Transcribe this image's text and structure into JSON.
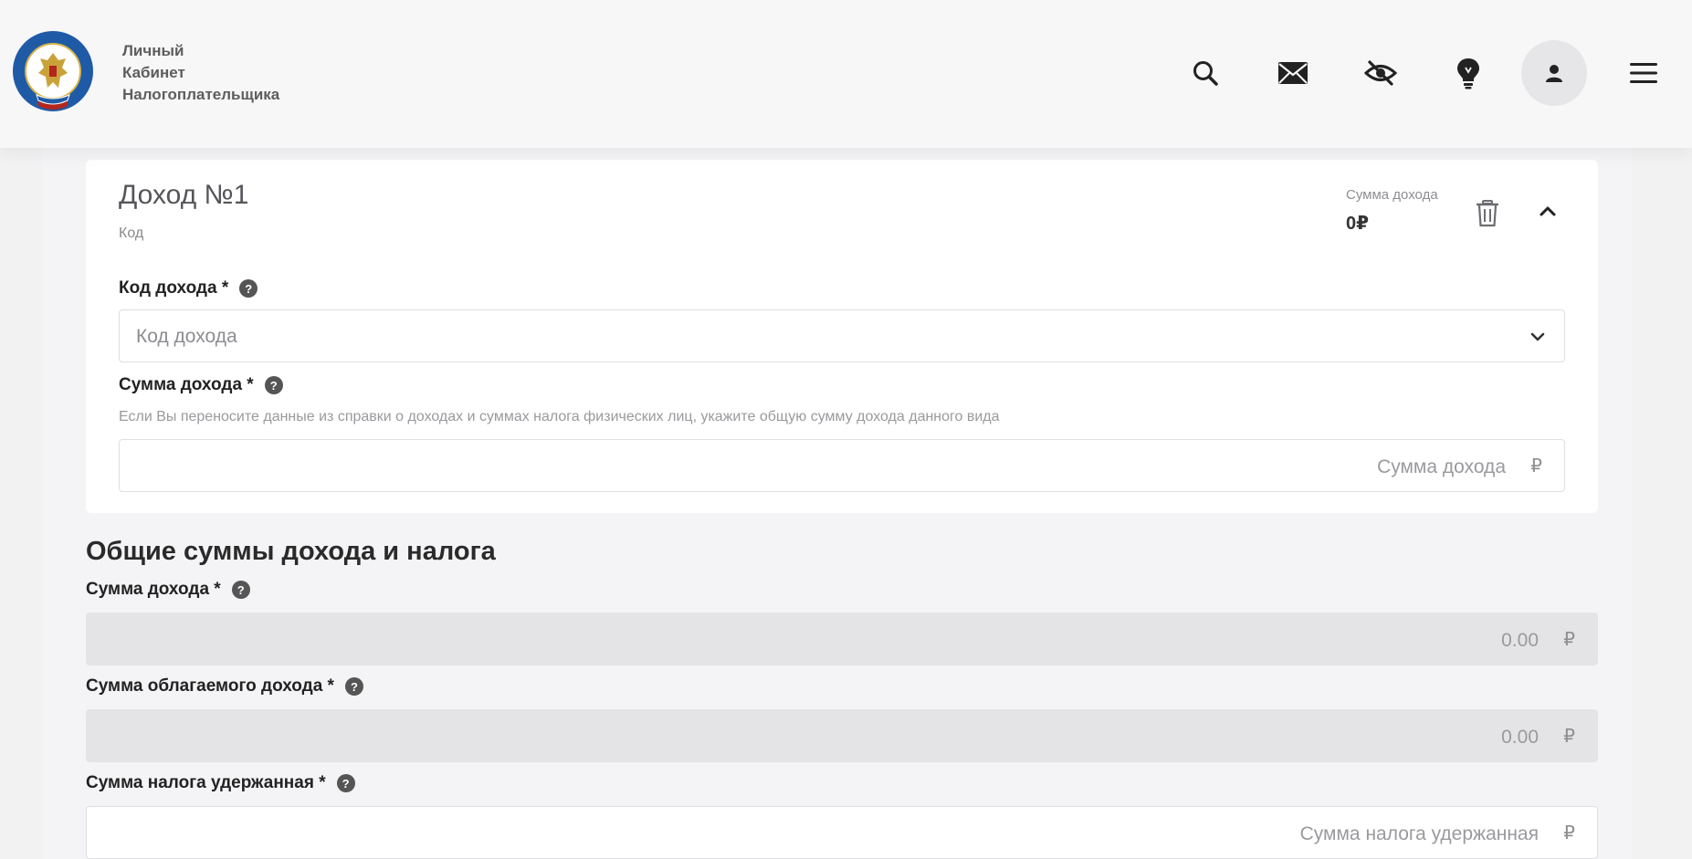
{
  "header": {
    "brand_line1": "Личный",
    "brand_line2": "Кабинет",
    "brand_line3": "Налогоплательщика",
    "icons": [
      "search-icon",
      "mail-icon",
      "eye-off-icon",
      "lightbulb-icon",
      "user-icon",
      "menu-icon"
    ]
  },
  "income_card": {
    "title": "Доход №1",
    "subtitle": "Код",
    "sum_label": "Сумма дохода",
    "sum_value": "0₽",
    "code_field": {
      "label": "Код дохода *",
      "placeholder": "Код дохода"
    },
    "amount_field": {
      "label": "Сумма дохода *",
      "hint": "Если Вы переносите данные из справки о доходах и суммах налога физических лиц, укажите общую сумму дохода данного вида",
      "placeholder": "Сумма дохода",
      "currency": "₽"
    }
  },
  "totals": {
    "title": "Общие суммы дохода и налога",
    "income_sum": {
      "label": "Сумма дохода *",
      "value": "0.00",
      "currency": "₽"
    },
    "taxable_sum": {
      "label": "Сумма облагаемого дохода *",
      "value": "0.00",
      "currency": "₽"
    },
    "withheld_tax": {
      "label": "Сумма налога удержанная *",
      "placeholder": "Сумма налога удержанная",
      "currency": "₽"
    }
  },
  "help_glyph": "?",
  "colors": {
    "header_bg": "#f7f7f8",
    "page_bg": "#f2f2f3",
    "disabled_field": "#e4e4e6",
    "logo_blue": "#1f5aa6"
  }
}
